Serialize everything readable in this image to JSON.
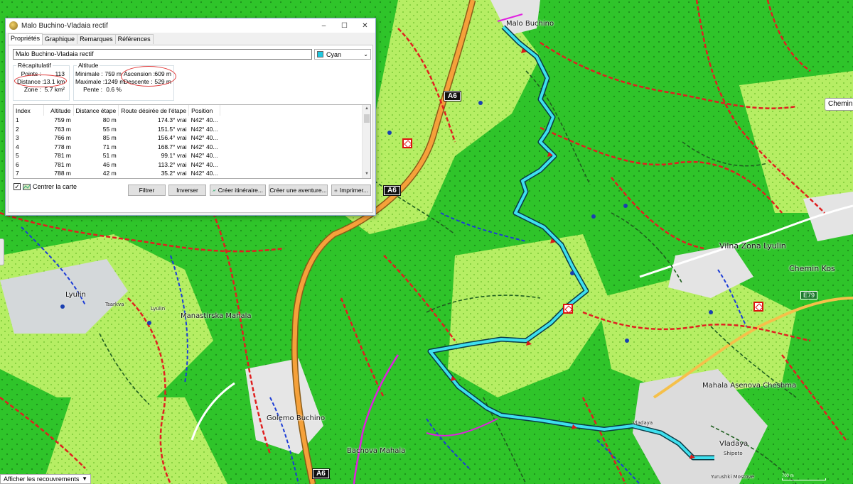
{
  "window": {
    "title": "Malo Buchino-Vladaia rectif",
    "controls": {
      "minimize": "–",
      "maximize": "☐",
      "close": "✕"
    },
    "tabs": [
      "Propriétés",
      "Graphique",
      "Remarques",
      "Références"
    ],
    "active_tab": "Propriétés",
    "name_value": "Malo Buchino-Vladaia rectif",
    "color": {
      "label": "Cyan",
      "hex": "#1ec8e0"
    },
    "summary": {
      "legend": "Récapitulatif",
      "points_label": "Points :",
      "points_value": "113",
      "distance_label": "Distance :",
      "distance_value": "13.1 km",
      "zone_label": "Zone :",
      "zone_value": "5.7 km²"
    },
    "altitude": {
      "legend": "Altitude",
      "min_label": "Minimale :",
      "min_value": "759 m",
      "max_label": "Maximale :",
      "max_value": "1249 m",
      "slope_label": "Pente :",
      "slope_value": "0.6 %",
      "ascent_label": "Ascension :",
      "ascent_value": "609 m",
      "descent_label": "Descente :",
      "descent_value": "529 m"
    },
    "table": {
      "columns": [
        "Index",
        "Altitude",
        "Distance étape",
        "Route désirée de l'étape",
        "Position"
      ],
      "rows": [
        [
          "1",
          "759 m",
          "80 m",
          "174.3° vrai",
          "N42° 40..."
        ],
        [
          "2",
          "763 m",
          "55 m",
          "151.5° vrai",
          "N42° 40..."
        ],
        [
          "3",
          "766 m",
          "85 m",
          "156.4° vrai",
          "N42° 40..."
        ],
        [
          "4",
          "778 m",
          "71 m",
          "168.7° vrai",
          "N42° 40..."
        ],
        [
          "5",
          "781 m",
          "51 m",
          "99.1° vrai",
          "N42° 40..."
        ],
        [
          "6",
          "781 m",
          "46 m",
          "113.2° vrai",
          "N42° 40..."
        ],
        [
          "7",
          "788 m",
          "42 m",
          "35.2° vrai",
          "N42° 40..."
        ]
      ]
    },
    "center_map": {
      "label": "Centrer la carte",
      "checked": "✓"
    },
    "buttons": {
      "filter": "Filtrer",
      "reverse": "Inverser",
      "create_route": "Créer itinéraire...",
      "create_adventure": "Créer une aventure...",
      "print": "Imprimer..."
    }
  },
  "map": {
    "places": {
      "malo_buchino": "Malo Buchino",
      "vilna_zona": "Vilna Zona Lyulin",
      "chemin_kos": "Chemin Kos",
      "lyulin": "Lyulin",
      "lyulin2": "Lyulin",
      "manastirska": "Manastirska Mahala",
      "golemo_buchino": "Golemo Buchino",
      "bachova": "Bachova Mahala",
      "asenova": "Mahala Asenova Cheshma",
      "vladaya": "Vladaya",
      "shipeto": "Shipeto",
      "yurushki": "Yurushki Mostove",
      "tsarkva": "Tsarkva",
      "vladaya_road": "Vladaya",
      "chemin_box": "Chemin"
    },
    "roads": {
      "a6": "A6",
      "e79": "E79"
    },
    "overlay_toggle": "Afficher les recouvrements",
    "scale": "700 m"
  }
}
